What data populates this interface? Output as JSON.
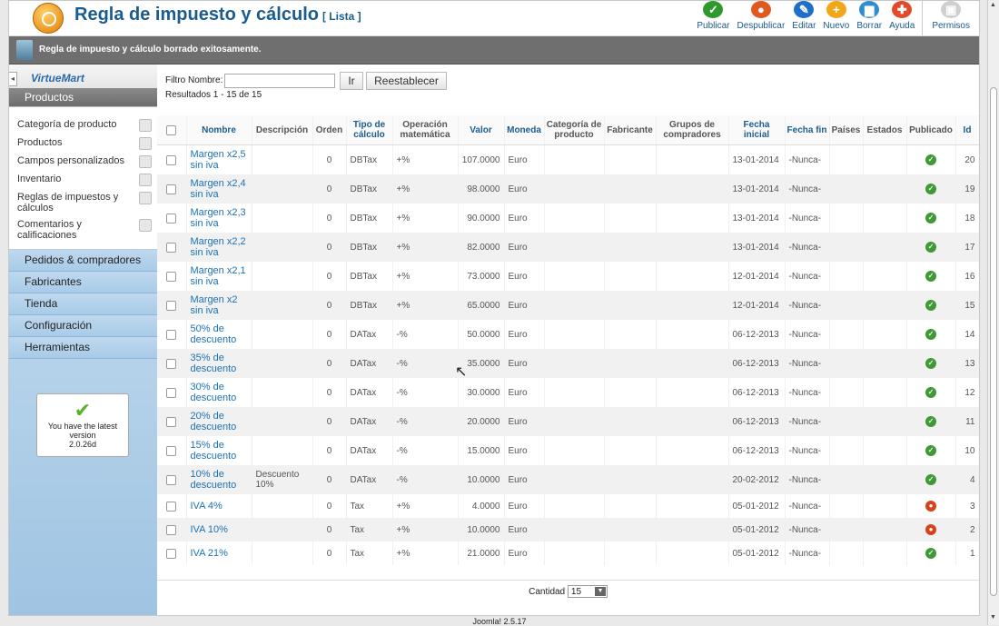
{
  "header": {
    "title": "Regla de impuesto y cálculo",
    "subtitle": "[ Lista ]",
    "toolbar": [
      {
        "label": "Publicar",
        "icon": "check-icon",
        "color": "#2e9a2e",
        "glyph": "✓"
      },
      {
        "label": "Despublicar",
        "icon": "unpublish-icon",
        "color": "#e05a1f",
        "glyph": "●"
      },
      {
        "label": "Editar",
        "icon": "pencil-icon",
        "color": "#1f6ec7",
        "glyph": "✎"
      },
      {
        "label": "Nuevo",
        "icon": "plus-icon",
        "color": "#f2a61a",
        "glyph": "+"
      },
      {
        "label": "Borrar",
        "icon": "trash-icon",
        "color": "#2f8cd1",
        "glyph": "▆"
      },
      {
        "label": "Ayuda",
        "icon": "lifebuoy-icon",
        "color": "#e14b2a",
        "glyph": "✚"
      },
      {
        "label": "Permisos",
        "icon": "lock-icon",
        "color": "#cfcfcf",
        "glyph": "▣"
      }
    ]
  },
  "message": "Regla de impuesto y cálculo borrado exitosamente.",
  "sidebar": {
    "brand": "VirtueMart",
    "section": "Productos",
    "subitems": [
      "Categoría de producto",
      "Productos",
      "Campos personalizados",
      "Inventario",
      "Reglas de impuestos y cálculos",
      "Comentarios y calificaciones"
    ],
    "sections": [
      "Pedidos & compradores",
      "Fabricantes",
      "Tienda",
      "Configuración",
      "Herramientas"
    ],
    "version": {
      "line1": "You have the latest",
      "line2": "version",
      "line3": "2.0.26d"
    }
  },
  "filter": {
    "label": "Filtro Nombre:",
    "value": "",
    "go": "Ir",
    "reset": "Reestablecer",
    "results": "Resultados 1 - 15 de 15"
  },
  "table": {
    "columns": [
      "Nombre",
      "Descripción",
      "Orden",
      "Tipo de cálculo",
      "Operación matemática",
      "Valor",
      "Moneda",
      "Categoría de producto",
      "Fabricante",
      "Grupos de compradores",
      "Fecha inicial",
      "Fecha fin",
      "Países",
      "Estados",
      "Publicado",
      "Id"
    ],
    "rows": [
      {
        "name": "Margen x2,5 sin iva",
        "desc": "",
        "order": "0",
        "type": "DBTax",
        "op": "+%",
        "value": "107.0000",
        "currency": "Euro",
        "start": "13-01-2014",
        "end": "-Nunca-",
        "published": true,
        "id": "20"
      },
      {
        "name": "Margen x2,4 sin iva",
        "desc": "",
        "order": "0",
        "type": "DBTax",
        "op": "+%",
        "value": "98.0000",
        "currency": "Euro",
        "start": "13-01-2014",
        "end": "-Nunca-",
        "published": true,
        "id": "19"
      },
      {
        "name": "Margen x2,3 sin iva",
        "desc": "",
        "order": "0",
        "type": "DBTax",
        "op": "+%",
        "value": "90.0000",
        "currency": "Euro",
        "start": "13-01-2014",
        "end": "-Nunca-",
        "published": true,
        "id": "18"
      },
      {
        "name": "Margen x2,2 sin iva",
        "desc": "",
        "order": "0",
        "type": "DBTax",
        "op": "+%",
        "value": "82.0000",
        "currency": "Euro",
        "start": "13-01-2014",
        "end": "-Nunca-",
        "published": true,
        "id": "17"
      },
      {
        "name": "Margen x2,1 sin iva",
        "desc": "",
        "order": "0",
        "type": "DBTax",
        "op": "+%",
        "value": "73.0000",
        "currency": "Euro",
        "start": "12-01-2014",
        "end": "-Nunca-",
        "published": true,
        "id": "16"
      },
      {
        "name": "Margen x2 sin iva",
        "desc": "",
        "order": "0",
        "type": "DBTax",
        "op": "+%",
        "value": "65.0000",
        "currency": "Euro",
        "start": "12-01-2014",
        "end": "-Nunca-",
        "published": true,
        "id": "15"
      },
      {
        "name": "50% de descuento",
        "desc": "",
        "order": "0",
        "type": "DATax",
        "op": "-%",
        "value": "50.0000",
        "currency": "Euro",
        "start": "06-12-2013",
        "end": "-Nunca-",
        "published": true,
        "id": "14"
      },
      {
        "name": "35% de descuento",
        "desc": "",
        "order": "0",
        "type": "DATax",
        "op": "-%",
        "value": "35.0000",
        "currency": "Euro",
        "start": "06-12-2013",
        "end": "-Nunca-",
        "published": true,
        "id": "13"
      },
      {
        "name": "30% de descuento",
        "desc": "",
        "order": "0",
        "type": "DATax",
        "op": "-%",
        "value": "30.0000",
        "currency": "Euro",
        "start": "06-12-2013",
        "end": "-Nunca-",
        "published": true,
        "id": "12"
      },
      {
        "name": "20% de descuento",
        "desc": "",
        "order": "0",
        "type": "DATax",
        "op": "-%",
        "value": "20.0000",
        "currency": "Euro",
        "start": "06-12-2013",
        "end": "-Nunca-",
        "published": true,
        "id": "11"
      },
      {
        "name": "15% de descuento",
        "desc": "",
        "order": "0",
        "type": "DATax",
        "op": "-%",
        "value": "15.0000",
        "currency": "Euro",
        "start": "06-12-2013",
        "end": "-Nunca-",
        "published": true,
        "id": "10"
      },
      {
        "name": "10% de descuento",
        "desc": "Descuento 10%",
        "order": "0",
        "type": "DATax",
        "op": "-%",
        "value": "10.0000",
        "currency": "Euro",
        "start": "20-02-2012",
        "end": "-Nunca-",
        "published": true,
        "id": "4"
      },
      {
        "name": "IVA 4%",
        "desc": "",
        "order": "0",
        "type": "Tax",
        "op": "+%",
        "value": "4.0000",
        "currency": "Euro",
        "start": "05-01-2012",
        "end": "-Nunca-",
        "published": false,
        "id": "3"
      },
      {
        "name": "IVA 10%",
        "desc": "",
        "order": "0",
        "type": "Tax",
        "op": "+%",
        "value": "10.0000",
        "currency": "Euro",
        "start": "05-01-2012",
        "end": "-Nunca-",
        "published": false,
        "id": "2"
      },
      {
        "name": "IVA 21%",
        "desc": "",
        "order": "0",
        "type": "Tax",
        "op": "+%",
        "value": "21.0000",
        "currency": "Euro",
        "start": "05-01-2012",
        "end": "-Nunca-",
        "published": true,
        "id": "1"
      }
    ]
  },
  "pagination": {
    "label": "Cantidad",
    "value": "15"
  },
  "footer": "Joomla! 2.5.17"
}
